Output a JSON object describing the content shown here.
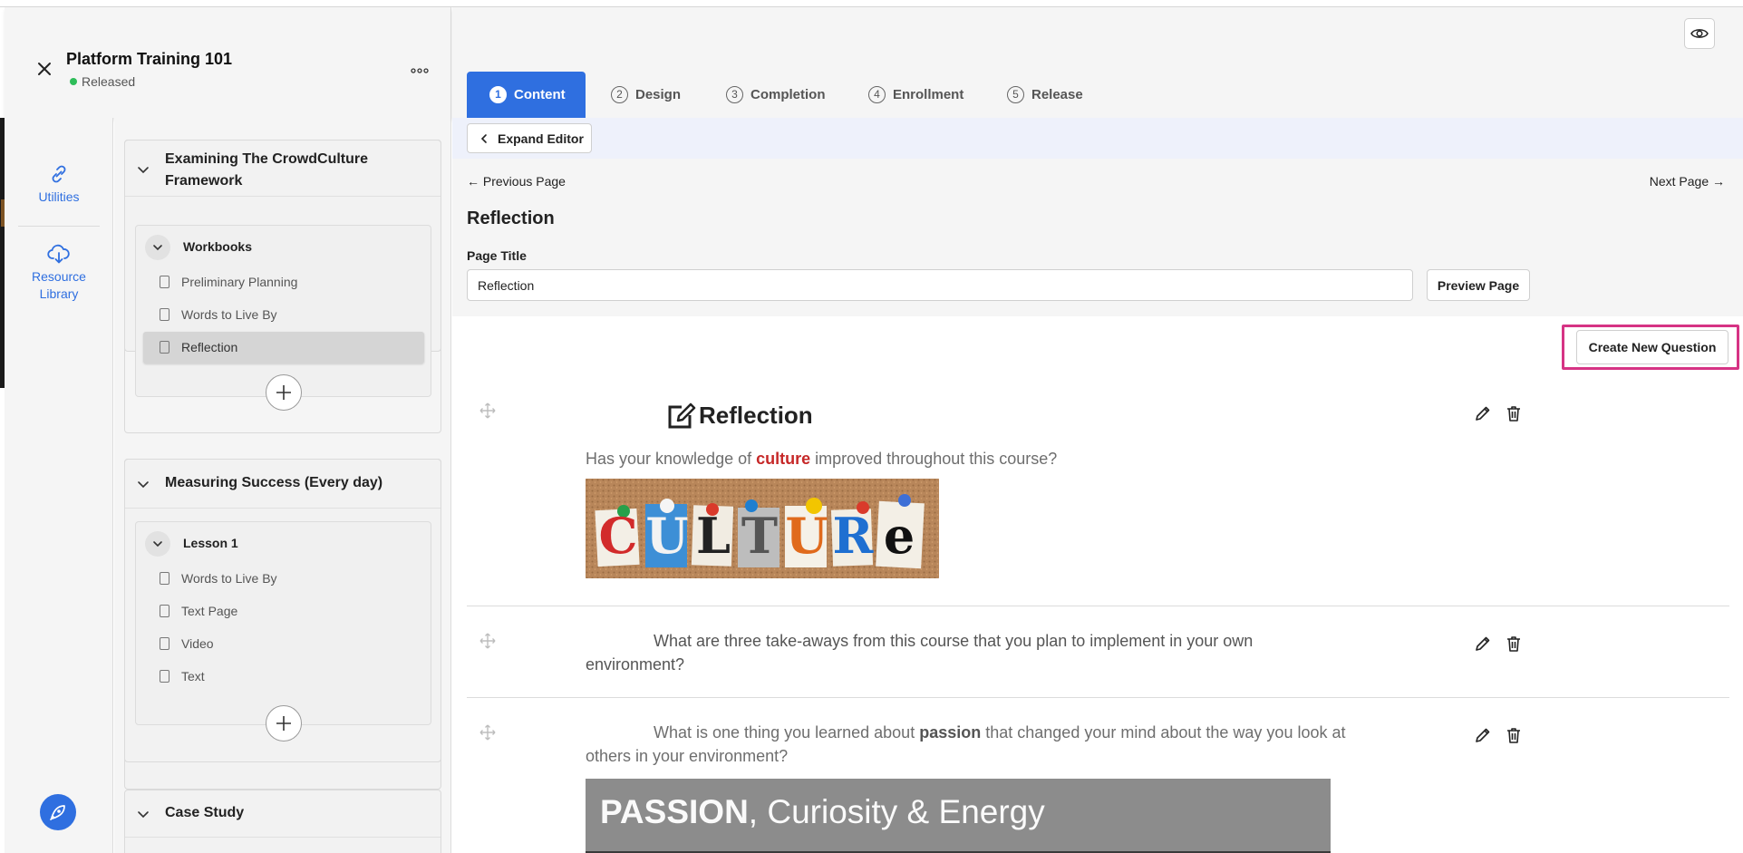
{
  "header": {
    "course_title": "Platform Training 101",
    "status": "Released",
    "status_color": "#2ebd59"
  },
  "rail": {
    "utilities_label": "Utilities",
    "resource_line1": "Resource",
    "resource_line2": "Library"
  },
  "outline": {
    "modules": [
      {
        "title": "Examining The CrowdCulture Framework",
        "lessons": [
          {
            "title": "Workbooks",
            "pages": [
              "Preliminary Planning",
              "Words to Live By",
              "Reflection"
            ],
            "selected_index": 2
          }
        ]
      },
      {
        "title": "Measuring Success (Every day)",
        "lessons": [
          {
            "title": "Lesson 1",
            "pages": [
              "Words to Live By",
              "Text Page",
              "Video",
              "Text"
            ]
          }
        ]
      },
      {
        "title": "Case Study",
        "lessons": []
      }
    ]
  },
  "tabs": [
    {
      "num": "1",
      "label": "Content",
      "active": true
    },
    {
      "num": "2",
      "label": "Design"
    },
    {
      "num": "3",
      "label": "Completion"
    },
    {
      "num": "4",
      "label": "Enrollment"
    },
    {
      "num": "5",
      "label": "Release"
    }
  ],
  "editor": {
    "expand_label": "Expand Editor",
    "prev_label": "Previous Page",
    "next_label": "Next Page",
    "page_heading": "Reflection",
    "page_title_label": "Page Title",
    "page_title_value": "Reflection",
    "preview_label": "Preview Page",
    "create_question_label": "Create New Question"
  },
  "questions": [
    {
      "heading": "Reflection",
      "text_before": "Has your knowledge of ",
      "highlight": "culture",
      "text_after": " improved throughout this course?",
      "image_letters": [
        "C",
        "U",
        "L",
        "T",
        "U",
        "R",
        "e"
      ]
    },
    {
      "text": "What are three take-aways from this course that you plan to implement in your own environment?"
    },
    {
      "text_before": "What is one thing you learned about ",
      "highlight": "passion",
      "text_after": " that changed your mind about the way you look at others in your environment?",
      "image_bold": "PASSION",
      "image_rest": ", Curiosity & Energy"
    }
  ],
  "icons": {
    "close": "close-icon",
    "more": "more-icon",
    "utilities": "link-icon",
    "resource": "cloud-download-icon",
    "eye": "eye-icon",
    "edit": "pencil-icon",
    "delete": "trash-icon",
    "drag": "move-icon"
  },
  "colors": {
    "accent": "#2f6fe0",
    "highlight_red": "#c62828",
    "focus_ring": "#d63384"
  }
}
